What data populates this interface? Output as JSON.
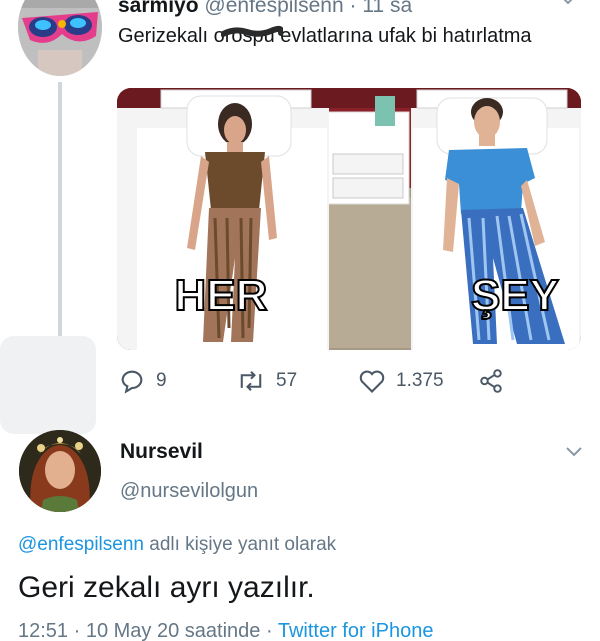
{
  "tweet": {
    "author_name": "sarmiyo",
    "author_handle": "@enfespilsenn",
    "time_separator": " · ",
    "time": "11 sa",
    "text": "Gerizekalı orospu evlatlarına ufak bi hatırlatma",
    "image": {
      "left_caption": "HER",
      "right_caption": "ŞEY"
    },
    "actions": {
      "reply_icon": "reply-icon",
      "reply_count": "9",
      "retweet_icon": "retweet-icon",
      "retweet_count": "57",
      "like_icon": "heart-icon",
      "like_count": "1.375",
      "share_icon": "share-icon"
    }
  },
  "reply": {
    "author_name": "Nursevil",
    "author_handle": "@nursevilolgun",
    "reply_to_mention": "@enfespilsenn",
    "reply_to_suffix": " adlı kişiye yanıt olarak",
    "text": "Geri zekalı ayrı yazılır.",
    "time": "12:51",
    "sep1": " · ",
    "date": "10 May 20 saatinde",
    "sep2": " · ",
    "source": "Twitter for iPhone"
  },
  "colors": {
    "link": "#1b95e0",
    "secondary_text": "#657786",
    "thread_line": "#cfd6dc"
  }
}
